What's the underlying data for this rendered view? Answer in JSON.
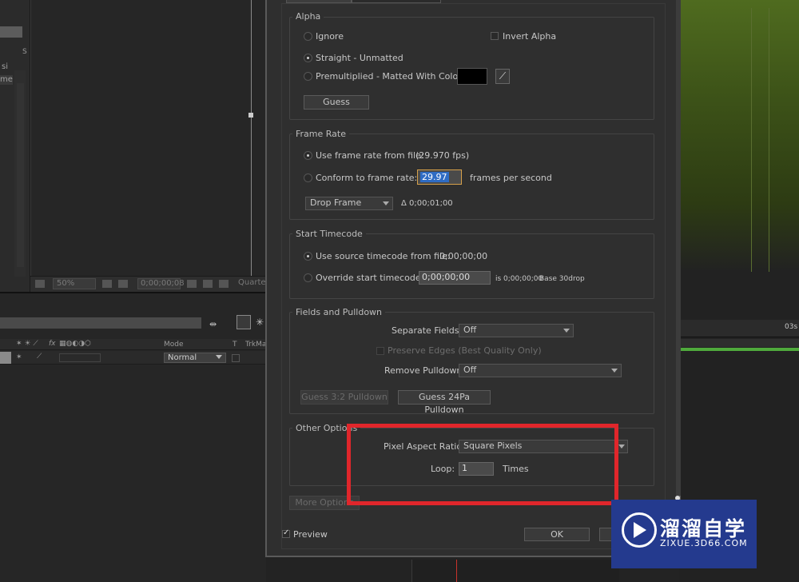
{
  "bg": {
    "zoom": "50%",
    "timecode": "0;00;00;08",
    "quarter": "Quarte",
    "left_texts": [
      "si",
      "me"
    ],
    "tab_s": "S",
    "col_mode": "Mode",
    "col_t": "T",
    "col_trkmat": "TrkMa",
    "layer_mode": "Normal",
    "ruler_time": "03s",
    "fx_label": "fx"
  },
  "dialog": {
    "alpha": {
      "title": "Alpha",
      "ignore": "Ignore",
      "invert_alpha": "Invert Alpha",
      "straight": "Straight - Unmatted",
      "premultiplied": "Premultiplied - Matted With Color:",
      "guess": "Guess"
    },
    "frame_rate": {
      "title": "Frame Rate",
      "use_from_file": "Use frame rate from file:",
      "file_fps": "(29.970 fps)",
      "conform": "Conform to frame rate:",
      "conform_value": "29.97",
      "fps_label": "frames per second",
      "drop_frame": "Drop Frame",
      "delta": "Δ 0;00;01;00"
    },
    "start_timecode": {
      "title": "Start Timecode",
      "use_source": "Use source timecode from file:",
      "source_value": "0;00;00;00",
      "override": "Override start timecode:",
      "override_value": "0;00;00;00",
      "is_text": "is 0;00;00;00",
      "base_text": "Base 30drop"
    },
    "fields": {
      "title": "Fields and Pulldown",
      "separate_label": "Separate Fields:",
      "separate_value": "Off",
      "preserve_edges": "Preserve Edges (Best Quality Only)",
      "remove_pulldown_label": "Remove Pulldown:",
      "remove_pulldown_value": "Off",
      "guess_32": "Guess 3:2 Pulldown",
      "guess_24pa": "Guess 24Pa Pulldown"
    },
    "other": {
      "title": "Other Options",
      "par_label": "Pixel Aspect Ratio:",
      "par_value": "Square Pixels",
      "loop_label": "Loop:",
      "loop_value": "1",
      "times": "Times"
    },
    "more_options": "More Options",
    "preview": "Preview",
    "ok": "OK"
  },
  "watermark": {
    "title": "溜溜自学",
    "subtitle": "ZIXUE.3D66.COM"
  },
  "colors": {
    "highlight_box": "#e0262b",
    "selection": "#2f6cc4",
    "watermark_bg": "#243a8e",
    "green_timeline": "#4faa3c"
  }
}
